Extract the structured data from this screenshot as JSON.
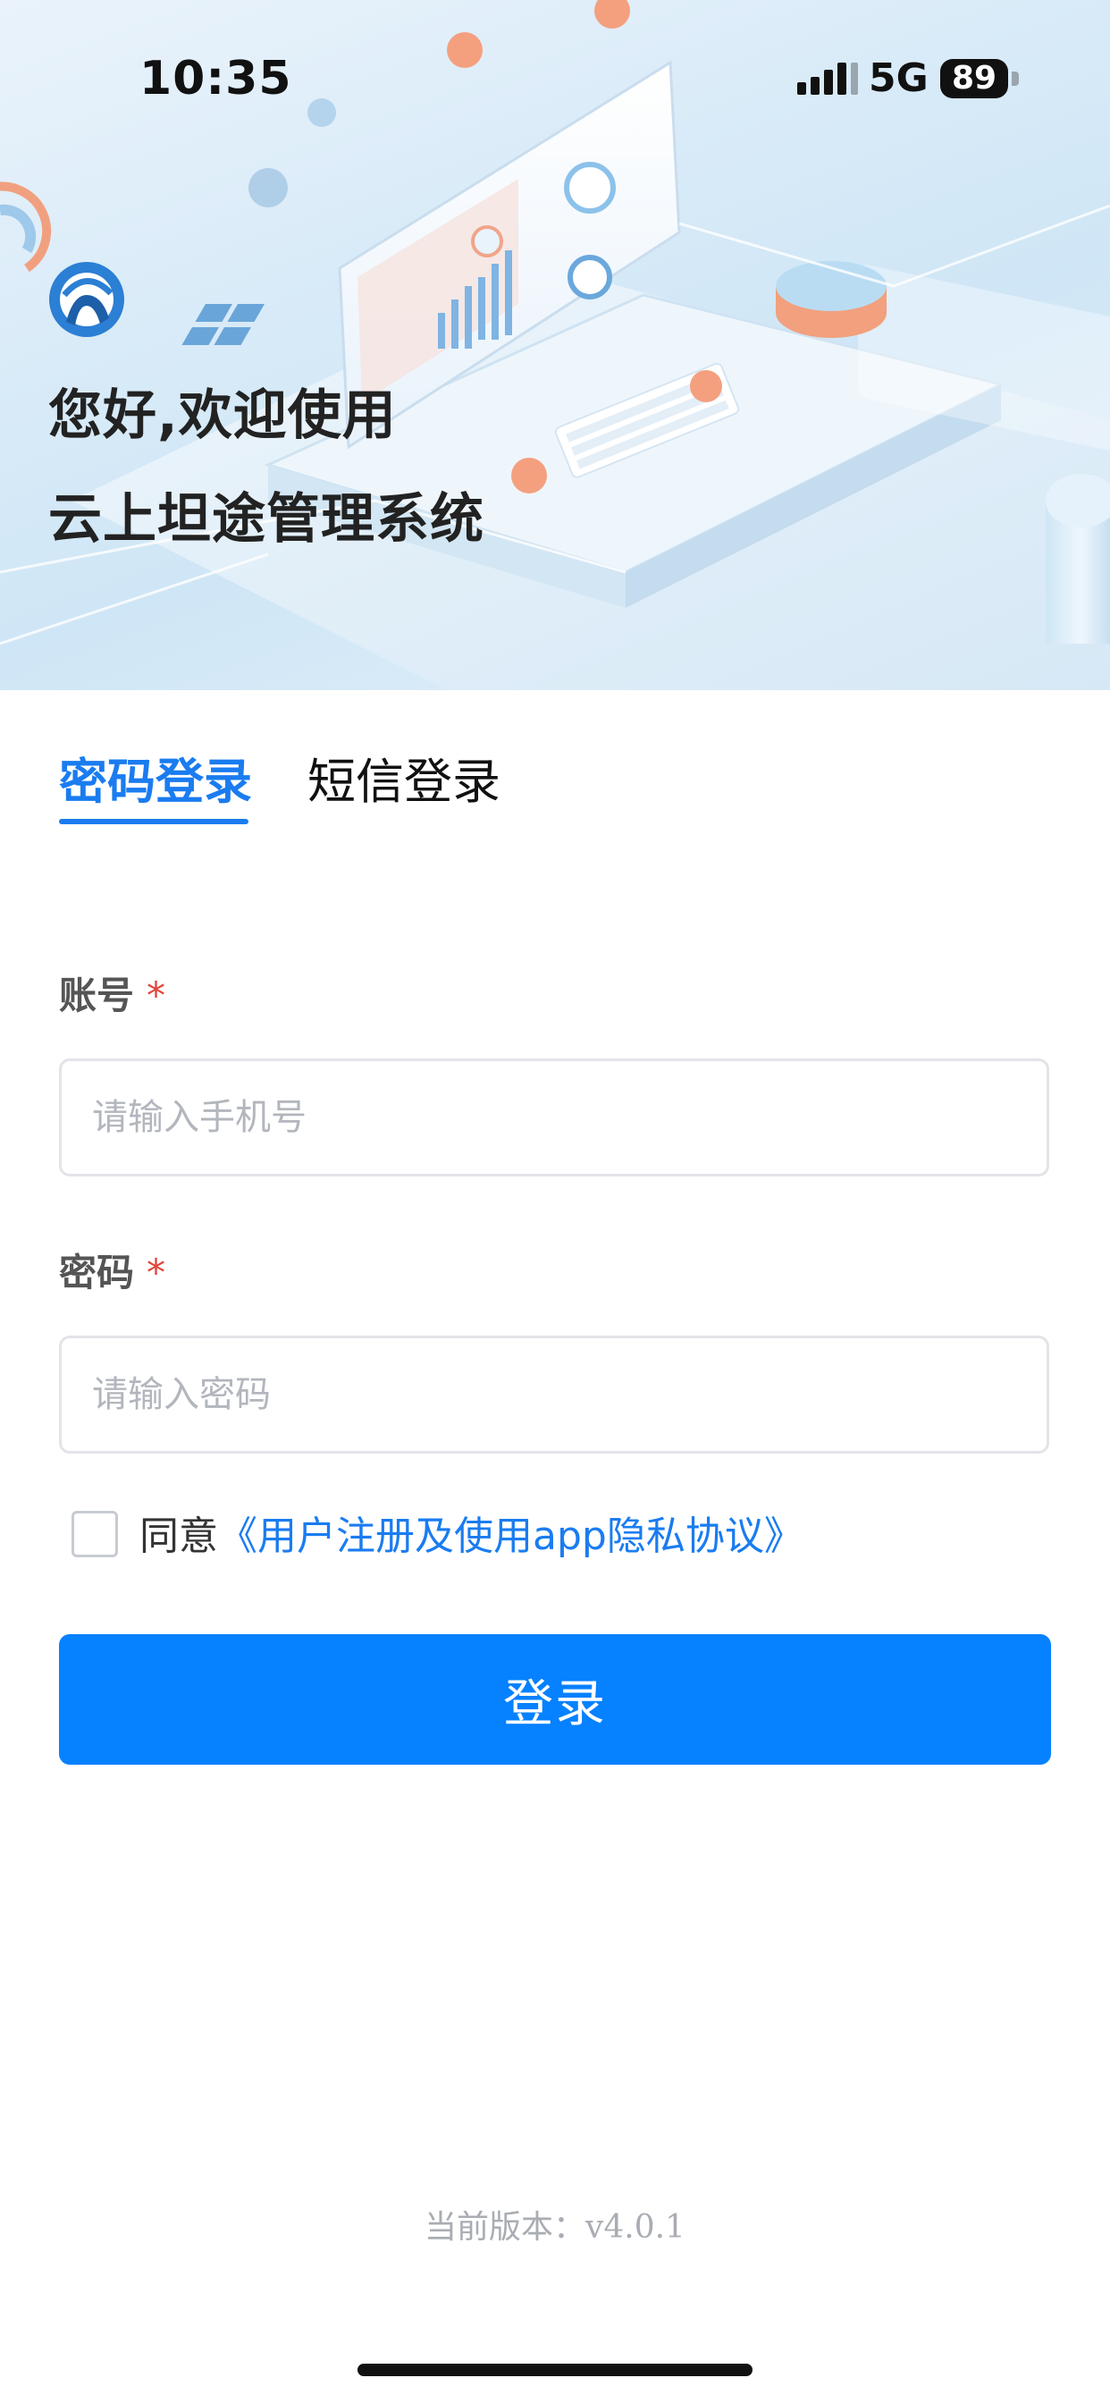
{
  "status_bar": {
    "time": "10:35",
    "network": "5G",
    "battery": "89",
    "icons": [
      "signal-icon",
      "battery-icon"
    ]
  },
  "header": {
    "greeting_line1": "您好,欢迎使用",
    "greeting_line2": "云上坦途管理系统",
    "logo_icon": "brand-logo"
  },
  "tabs": [
    {
      "label": "密码登录",
      "active": true
    },
    {
      "label": "短信登录",
      "active": false
    }
  ],
  "form": {
    "account": {
      "label": "账号",
      "required": "*",
      "placeholder": "请输入手机号",
      "value": ""
    },
    "password": {
      "label": "密码",
      "required": "*",
      "placeholder": "请输入密码",
      "value": ""
    },
    "agreement": {
      "prefix": "同意",
      "link": "《用户注册及使用app隐私协议》",
      "checked": false
    },
    "submit_label": "登录"
  },
  "footer": {
    "version_text": "当前版本：v4.0.1"
  },
  "colors": {
    "accent": "#1a7cf0",
    "button": "#0681ff",
    "required": "#e0453a"
  }
}
